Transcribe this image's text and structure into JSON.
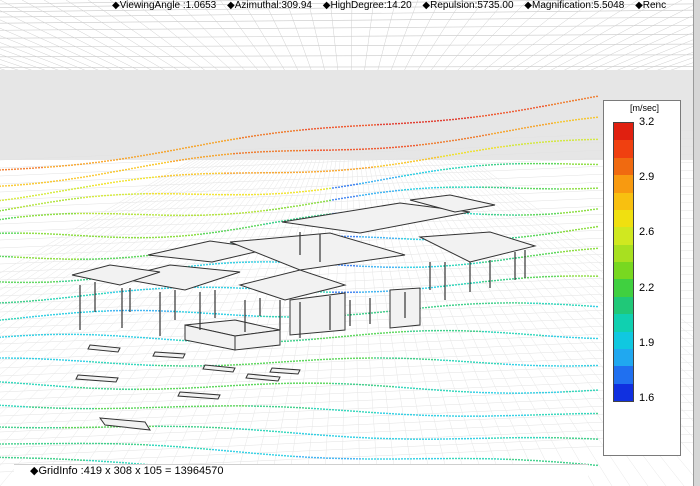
{
  "status_bar": {
    "items": [
      "◆ViewingAngle :1.0653",
      "◆Azimuthal:309.94",
      "◆HighDegree:14.20",
      "◆Repulsion:5735.00",
      "◆Magnification:5.5048",
      "◆Renc"
    ]
  },
  "legend": {
    "unit": "[m/sec]",
    "ticks": [
      "3.2",
      "2.9",
      "2.6",
      "2.2",
      "1.9",
      "1.6"
    ],
    "color_stops": [
      "#e02010",
      "#f04010",
      "#f06a10",
      "#f89a10",
      "#f8c010",
      "#f0e010",
      "#d0e820",
      "#a8e020",
      "#78d820",
      "#40d040",
      "#20c878",
      "#10d0b0",
      "#10c8e0",
      "#20a8f0",
      "#2070f0",
      "#1030e0"
    ]
  },
  "grid_info": {
    "label": "◆GridInfo :419 x 308 x 105 = 13964570"
  },
  "colors": {
    "streamline_slow": "#1030e0",
    "streamline_fast": "#e02010",
    "building": "#f2f2f2",
    "building_edge": "#333333"
  }
}
